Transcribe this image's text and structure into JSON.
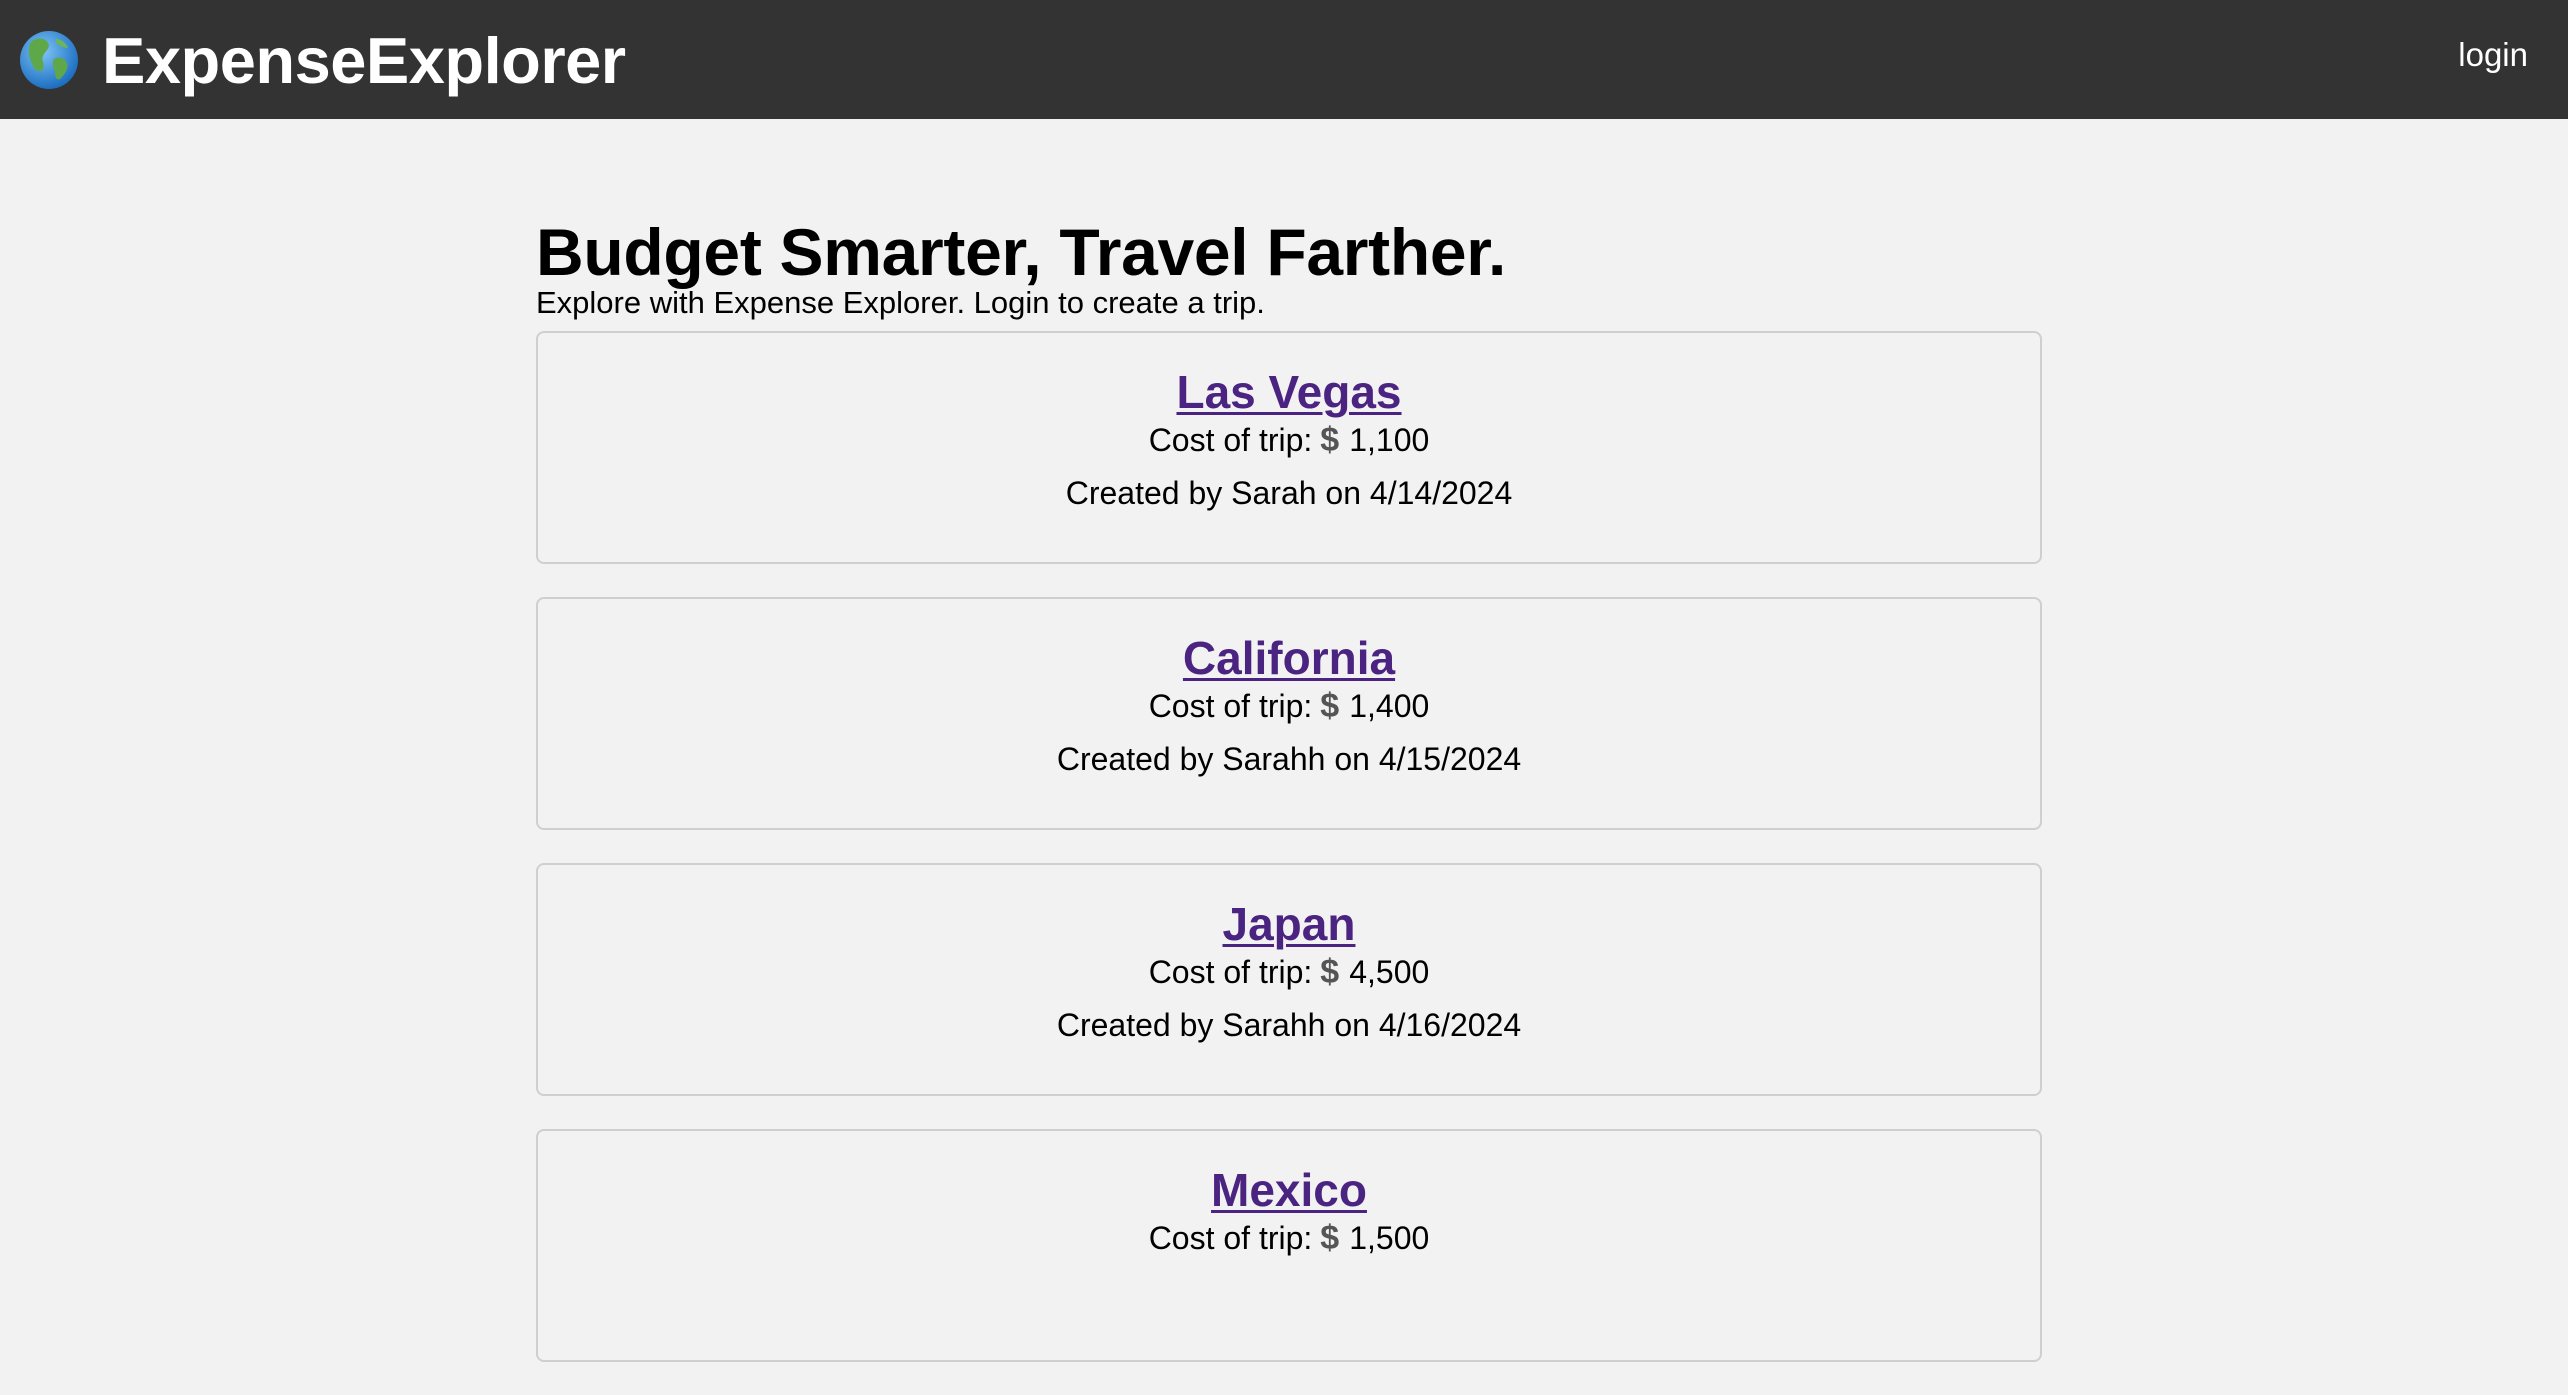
{
  "navbar": {
    "brand": "ExpenseExplorer",
    "globe_icon": "globe-icon",
    "login_label": "login",
    "background": "#333333"
  },
  "hero": {
    "title": "Budget Smarter, Travel Farther.",
    "subtitle": "Explore with Expense Explorer. Login to create a trip."
  },
  "trips": [
    {
      "name": "Las Vegas",
      "cost_label": "Cost of trip:",
      "currency_symbol": "$",
      "cost": "1,100",
      "created": "Created by Sarah on 4/14/2024"
    },
    {
      "name": "California",
      "cost_label": "Cost of trip:",
      "currency_symbol": "$",
      "cost": "1,400",
      "created": "Created by Sarahh on 4/15/2024"
    },
    {
      "name": "Japan",
      "cost_label": "Cost of trip:",
      "currency_symbol": "$",
      "cost": "4,500",
      "created": "Created by Sarahh on 4/16/2024"
    },
    {
      "name": "Mexico",
      "cost_label": "Cost of trip:",
      "currency_symbol": "$",
      "cost": "1,500",
      "created": ""
    }
  ],
  "colors": {
    "page_background": "#f2f2f2",
    "link_purple": "#4b2482",
    "card_border": "#cfcfcf"
  }
}
